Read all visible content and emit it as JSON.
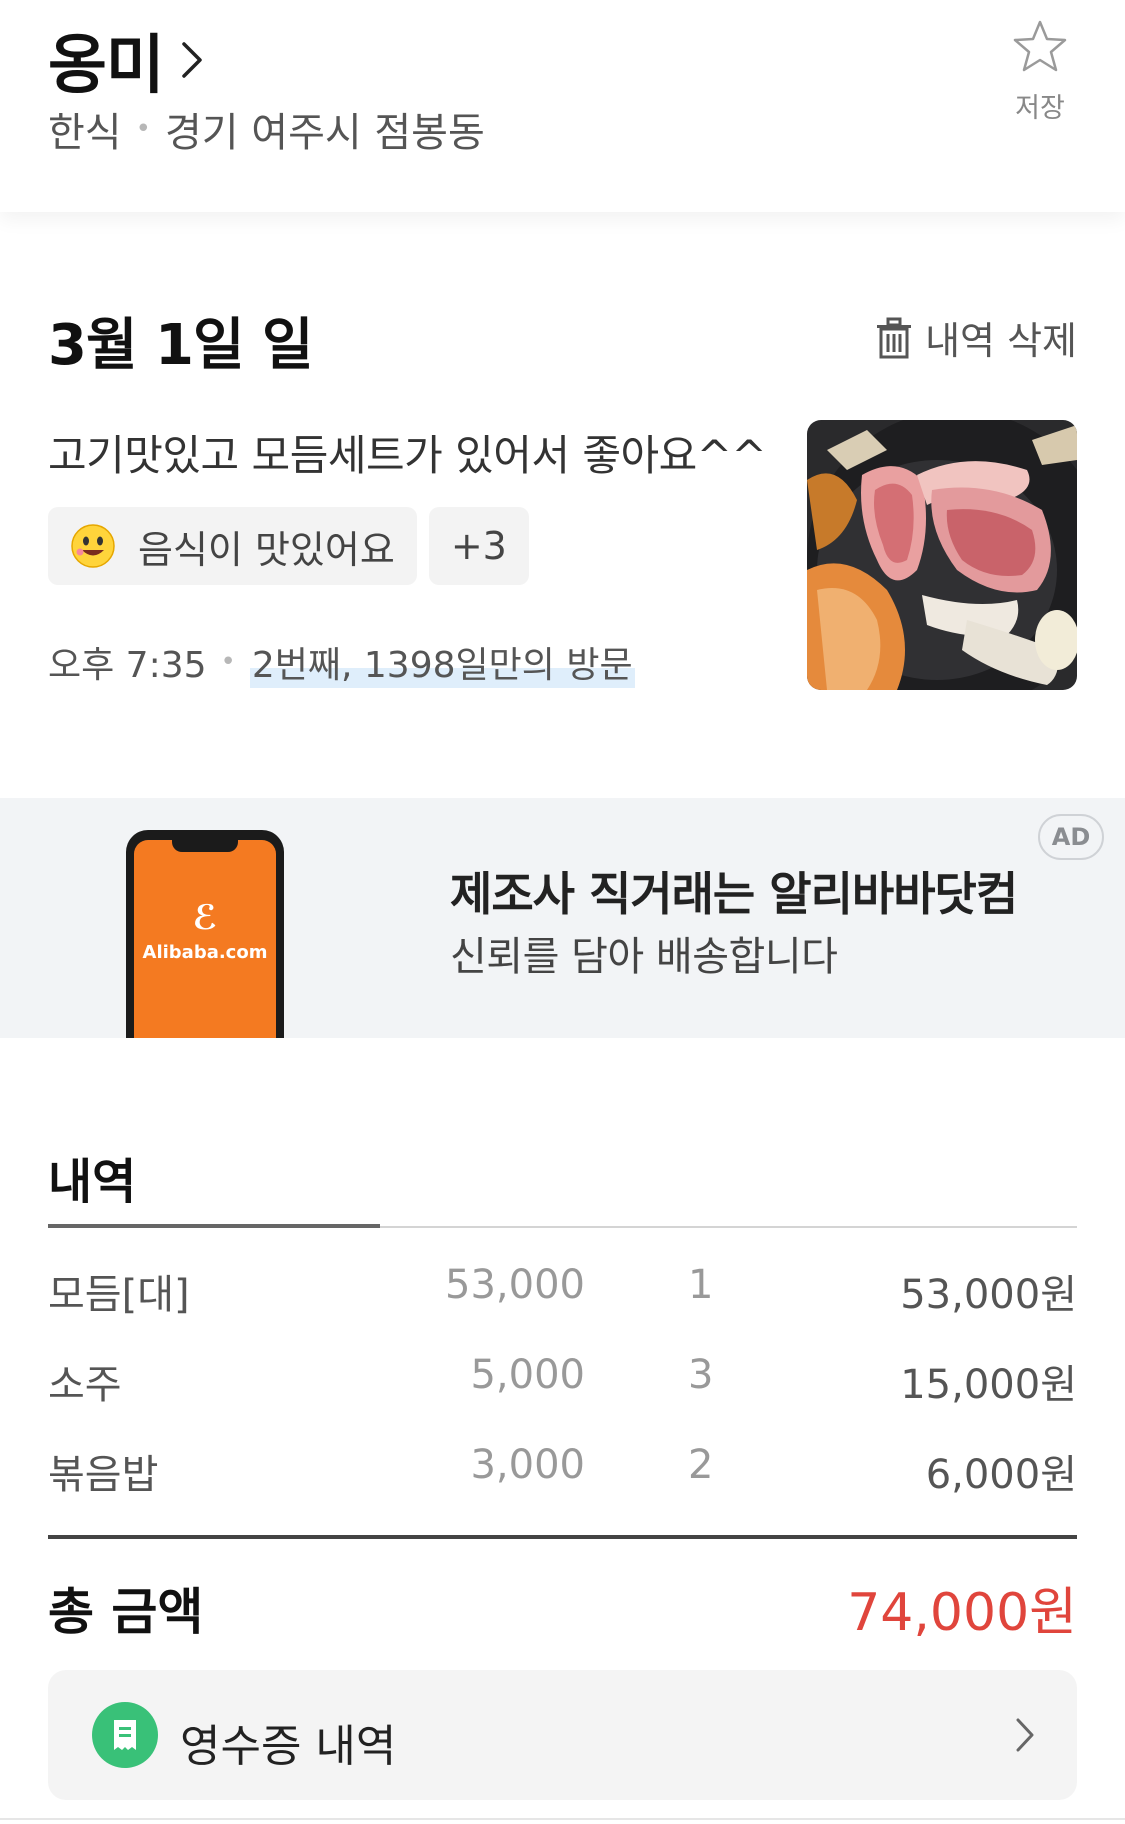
{
  "header": {
    "store_name": "옹미",
    "category": "한식",
    "location": "경기 여주시 점봉동",
    "save_label": "저장"
  },
  "review": {
    "date": "3월 1일 일",
    "delete_label": "내역 삭제",
    "text": "고기맛있고 모듬세트가 있어서 좋아요^^",
    "tag": "음식이 맛있어요",
    "tag_more": "+3",
    "time": "오후 7:35",
    "visit_info": "2번째, 1398일만의 방문"
  },
  "ad": {
    "headline": "제조사 직거래는 알리바바닷컴",
    "subline": "신뢰를 담아 배송합니다",
    "badge": "AD",
    "brand": "Alibaba.com"
  },
  "history": {
    "title": "내역",
    "items": [
      {
        "name": "모듬[대]",
        "price": "53,000",
        "qty": "1",
        "total": "53,000원"
      },
      {
        "name": "소주",
        "price": "5,000",
        "qty": "3",
        "total": "15,000원"
      },
      {
        "name": "볶음밥",
        "price": "3,000",
        "qty": "2",
        "total": "6,000원"
      }
    ],
    "total_label": "총 금액",
    "total_value": "74,000원",
    "receipt_label": "영수증 내역"
  },
  "colors": {
    "total_red": "#e0453c",
    "receipt_green": "#39c178",
    "ad_bg": "#f2f4f6",
    "alibaba_orange": "#f47a21"
  }
}
